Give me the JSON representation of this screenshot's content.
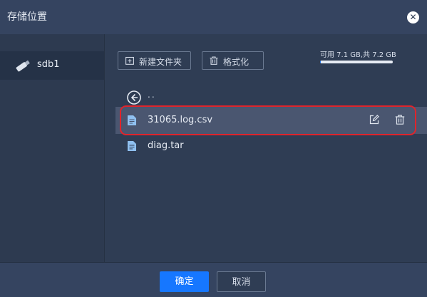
{
  "dialog": {
    "title": "存储位置",
    "close_icon": "close-icon"
  },
  "sidebar": {
    "drives": [
      {
        "label": "sdb1",
        "icon": "usb-drive-icon"
      }
    ]
  },
  "toolbar": {
    "new_folder_label": "新建文件夹",
    "new_folder_icon": "new-folder-icon",
    "format_label": "格式化",
    "format_icon": "trash-icon"
  },
  "storage": {
    "text": "可用 7.1 GB,共 7.2 GB",
    "used_fraction": 0.014
  },
  "listing": {
    "parent_label": "..",
    "files": [
      {
        "name": "31065.log.csv",
        "selected": true
      },
      {
        "name": "diag.tar",
        "selected": false
      }
    ]
  },
  "footer": {
    "ok_label": "确定",
    "cancel_label": "取消"
  },
  "colors": {
    "accent": "#1677ff",
    "highlight": "#e0242b",
    "background": "#2f3d54"
  }
}
